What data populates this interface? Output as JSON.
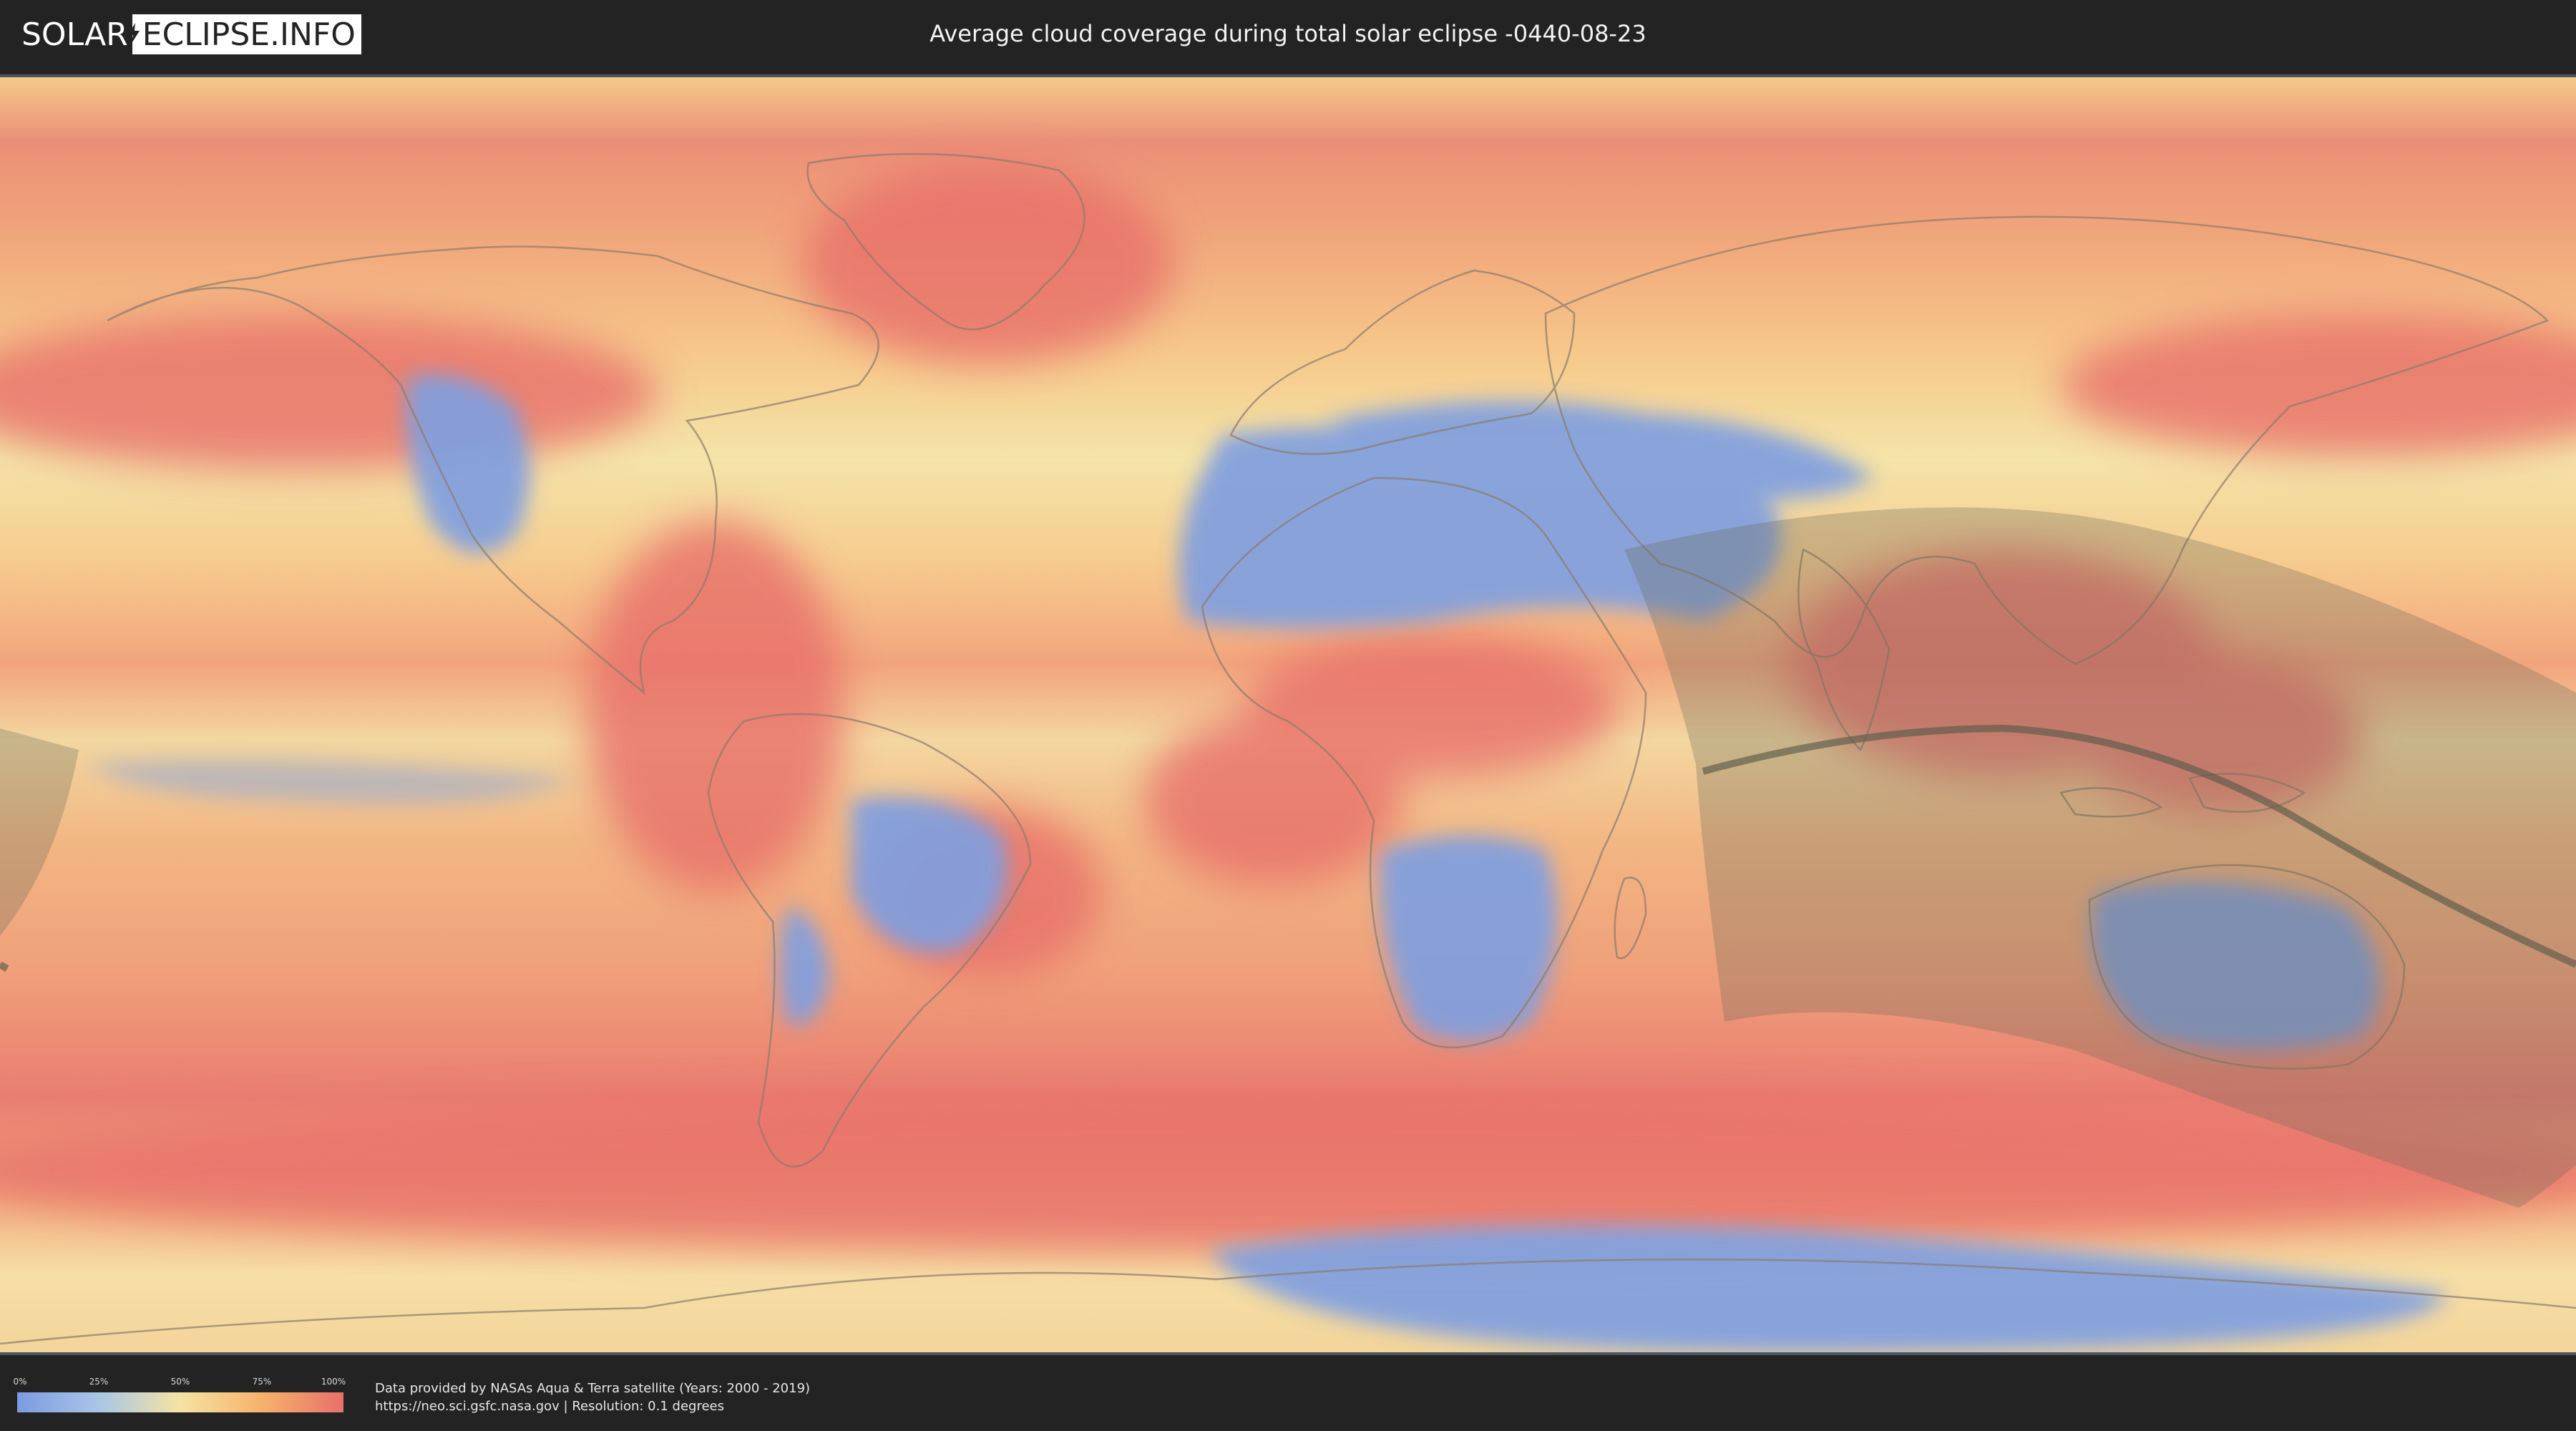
{
  "header": {
    "logo_part1": "SOLAR",
    "logo_part2": "ECLIPSE.INFO",
    "title": "Average cloud coverage during total solar eclipse -0440-08-23"
  },
  "legend": {
    "ticks": [
      "0%",
      "25%",
      "50%",
      "75%",
      "100%"
    ],
    "gradient_colors": [
      "#7b9be0",
      "#a9c6e6",
      "#f5e3a3",
      "#f6b26b",
      "#e8706a"
    ]
  },
  "credits": {
    "line1": "Data provided by NASAs Aqua & Terra satellite (Years: 2000 - 2019)",
    "line2": "https://neo.sci.gsfc.nasa.gov | Resolution: 0.1 degrees"
  },
  "colors": {
    "low_cloud": "#7b9be0",
    "mid_cloud": "#f5e3a3",
    "high_cloud": "#e8706a",
    "eclipse_shadow": "#6b6b5a",
    "background": "#232323"
  }
}
